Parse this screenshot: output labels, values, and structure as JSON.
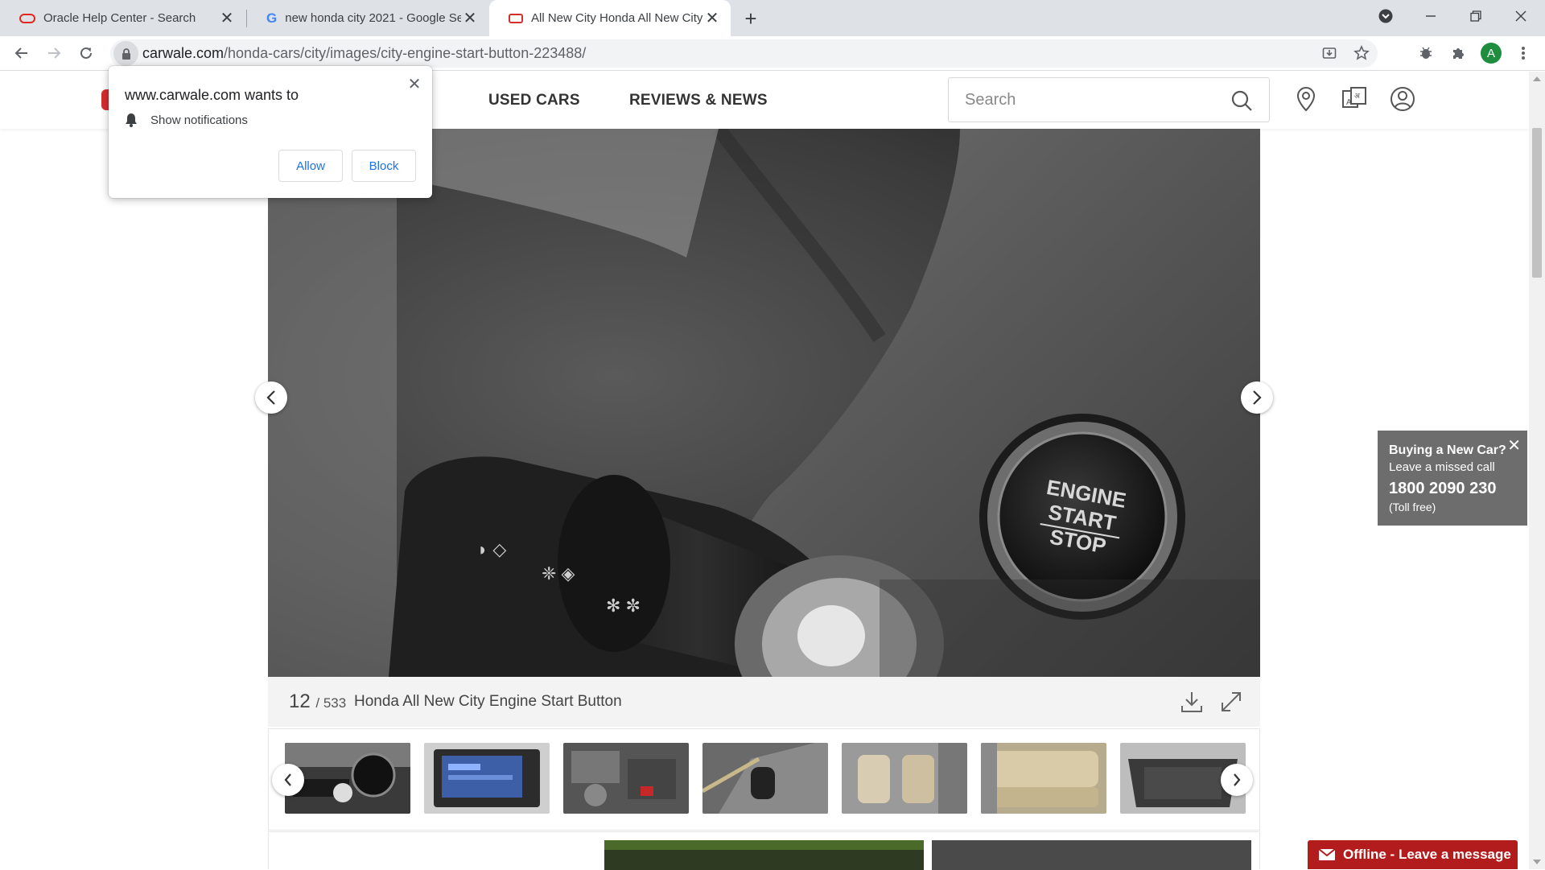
{
  "browser": {
    "tabs": [
      {
        "title": "Oracle Help Center - Search",
        "favicon": "oracle-icon",
        "active": false
      },
      {
        "title": "new honda city 2021 - Google Se",
        "favicon": "google-icon",
        "active": false
      },
      {
        "title": "All New City Honda All New City",
        "favicon": "carwale-icon",
        "active": true
      }
    ],
    "url": {
      "domain": "carwale.com",
      "path": "/honda-cars/city/images/city-engine-start-button-223488/"
    },
    "profile_initial": "A"
  },
  "permission_popup": {
    "title": "www.carwale.com wants to",
    "permission": "Show notifications",
    "allow_label": "Allow",
    "block_label": "Block"
  },
  "site_header": {
    "nav": [
      "USED CARS",
      "REVIEWS & NEWS"
    ],
    "search_placeholder": "Search"
  },
  "gallery": {
    "image_text": [
      "ENGINE",
      "START",
      "STOP"
    ],
    "current_index": "12",
    "total": "/ 533",
    "caption": "Honda All New City Engine Start Button"
  },
  "missed_call": {
    "title": "Buying a New Car?",
    "subtitle": "Leave a missed call",
    "phone": "1800 2090 230",
    "note": "(Toll free)"
  },
  "offline_chat": {
    "label": "Offline - Leave a message"
  },
  "colors": {
    "brand_red": "#b31c1c",
    "link_blue": "#1a73e8",
    "widget_grey": "#6d6d6d"
  }
}
